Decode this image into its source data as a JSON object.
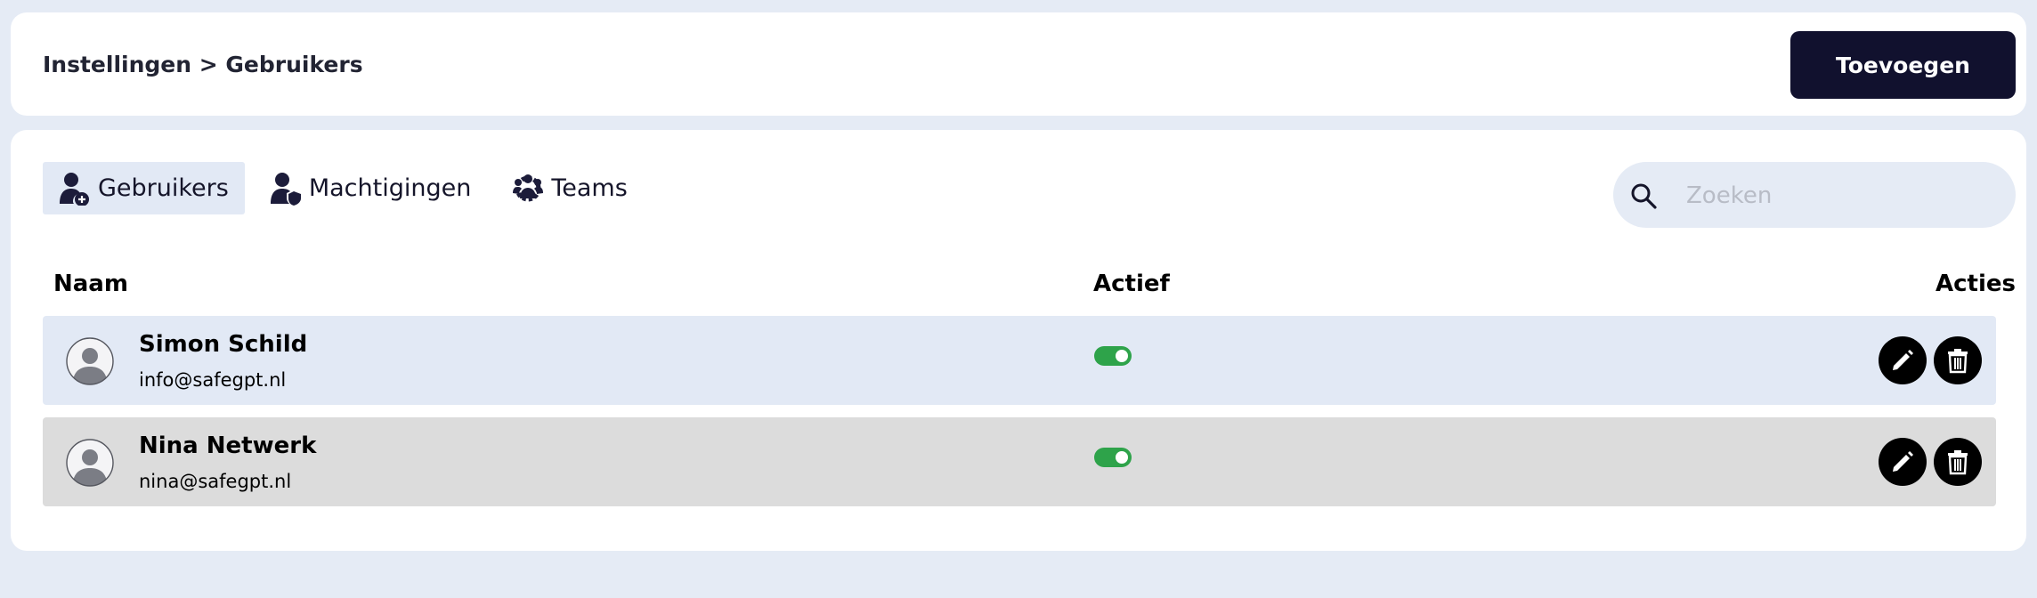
{
  "header": {
    "breadcrumb": "Instellingen > Gebruikers",
    "add_button": "Toevoegen"
  },
  "tabs": [
    {
      "label": "Gebruikers",
      "icon": "user-plus-icon",
      "active": true
    },
    {
      "label": "Machtigingen",
      "icon": "user-shield-icon",
      "active": false
    },
    {
      "label": "Teams",
      "icon": "users-gear-icon",
      "active": false
    }
  ],
  "search": {
    "placeholder": "Zoeken",
    "value": ""
  },
  "table": {
    "columns": [
      "Naam",
      "Actief",
      "Acties"
    ],
    "rows": [
      {
        "name": "Simon Schild",
        "email": "info@safegpt.nl",
        "active": true
      },
      {
        "name": "Nina Netwerk",
        "email": "nina@safegpt.nl",
        "active": true
      }
    ]
  },
  "colors": {
    "background": "#e5ebf5",
    "primary": "#11112e",
    "toggle_on": "#2ea34a",
    "row_highlight": "#e2e9f5",
    "row_alt": "#dcdcdc"
  }
}
